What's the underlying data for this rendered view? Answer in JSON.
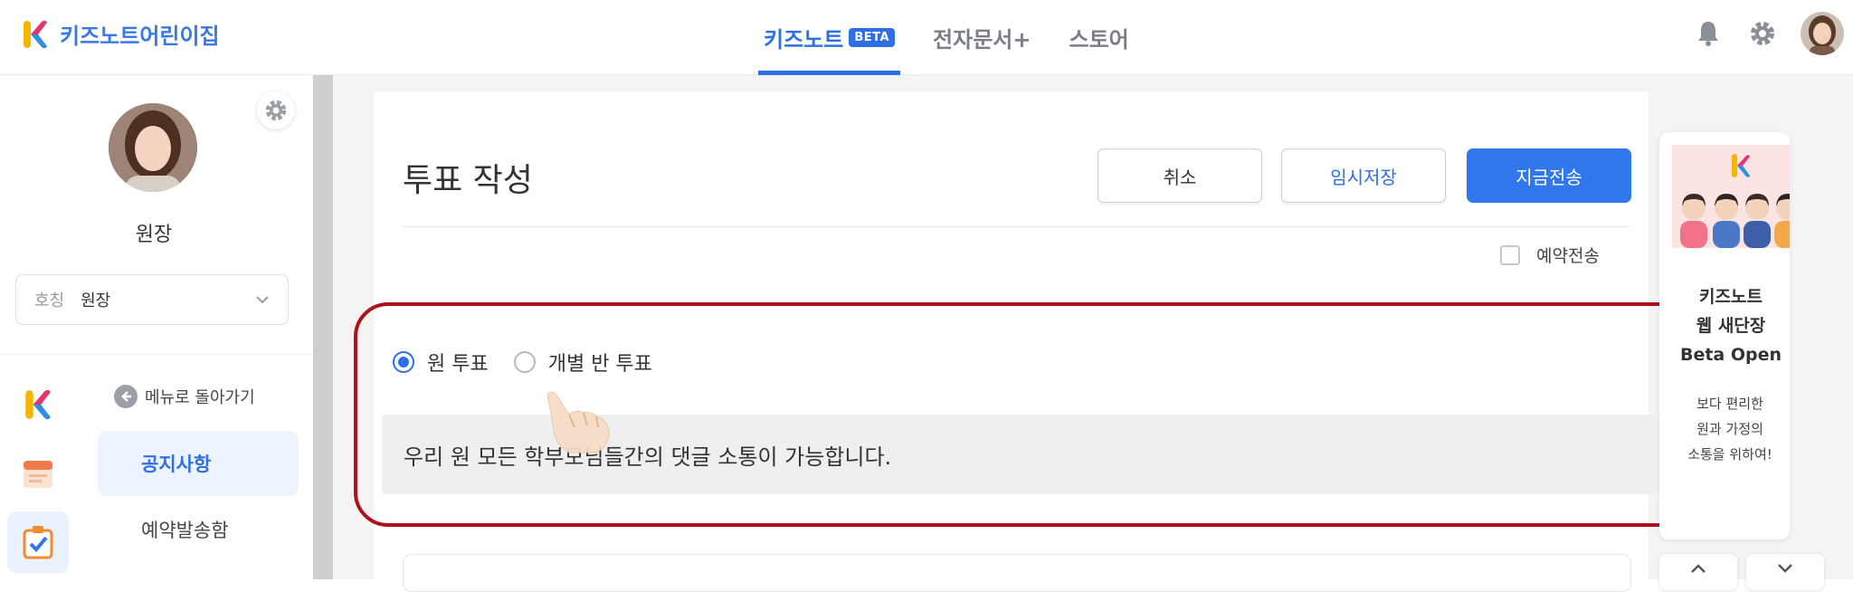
{
  "app": {
    "name": "키즈노트어린이집"
  },
  "nav": {
    "kidsnote": "키즈노트",
    "beta": "BETA",
    "edocs": "전자문서+",
    "store": "스토어"
  },
  "profile": {
    "name": "원장",
    "title_label": "호칭",
    "title_value": "원장"
  },
  "sidebar": {
    "back_label": "메뉴로 돌아가기",
    "items": [
      "공지사항",
      "예약발송함"
    ]
  },
  "page": {
    "title": "투표 작성"
  },
  "buttons": {
    "cancel": "취소",
    "draft": "임시저장",
    "send_now": "지금전송"
  },
  "reserve": {
    "label": "예약전송",
    "checked": false
  },
  "vote": {
    "options": [
      {
        "label": "원 투표",
        "selected": true
      },
      {
        "label": "개별 반 투표",
        "selected": false
      }
    ],
    "description": "우리 원 모든 학부모님들간의 댓글 소통이 가능합니다."
  },
  "ad": {
    "title_lines": [
      "키즈노트",
      "웹 새단장",
      "Beta Open"
    ],
    "body_lines": [
      "보다 편리한",
      "원과 가정의",
      "소통을 위하여!"
    ]
  },
  "colors": {
    "brand_blue": "#2f6fe4",
    "highlight_red": "#b0101a",
    "background_gray": "#f4f4f4"
  }
}
